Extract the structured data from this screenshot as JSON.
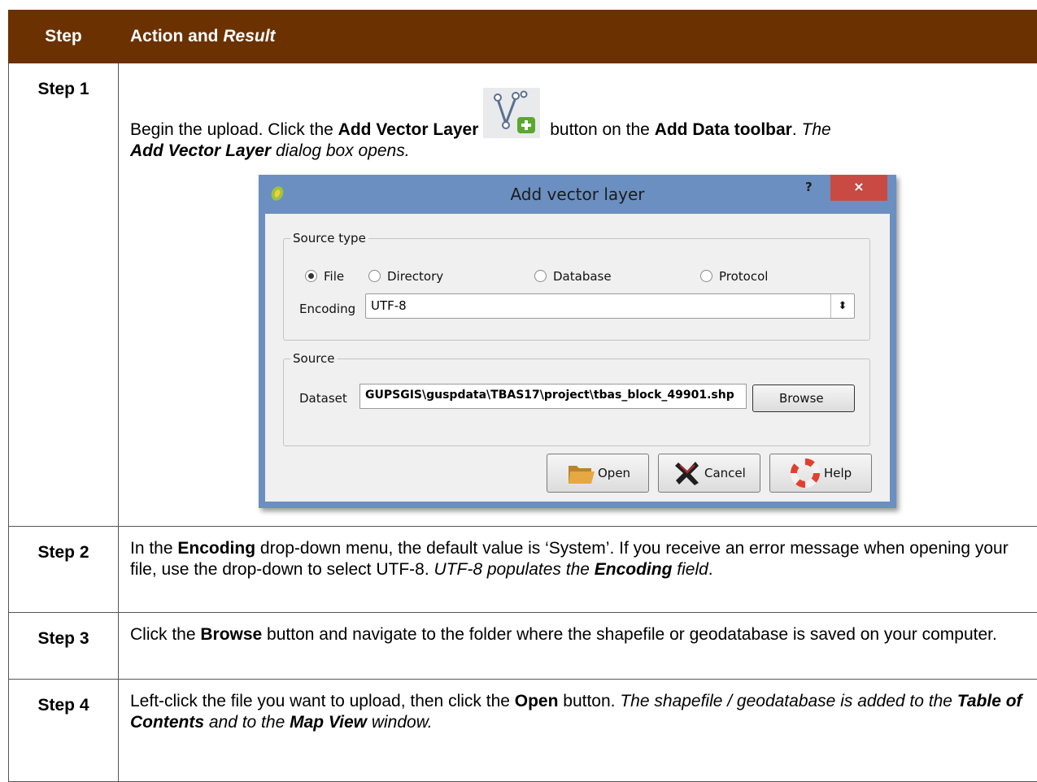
{
  "table": {
    "header": {
      "step": "Step",
      "action_plain": "Action and ",
      "action_italic": "Result"
    },
    "rows": [
      {
        "step": "Step 1"
      },
      {
        "step": "Step 2"
      },
      {
        "step": "Step 3"
      },
      {
        "step": "Step 4"
      }
    ]
  },
  "step1": {
    "t1": "Begin the upload. Click the ",
    "b1": "Add Vector Layer",
    "t2": " button on the ",
    "b2": "Add Data toolbar",
    "t3": ". ",
    "i1": "The",
    "bi1": "Add Vector Layer",
    "i2": " dialog box opens."
  },
  "step2": {
    "t1": "In the ",
    "b1": "Encoding",
    "t2": " drop-down menu, the default value is ‘System’. If you receive an error message when opening your file, use the drop-down to select UTF-8. ",
    "i1": "UTF-8 populates the ",
    "bi1": "Encoding",
    "i2": " field",
    "t3": "."
  },
  "step3": {
    "t1": "Click the ",
    "b1": "Browse",
    "t2": " button and navigate to the folder where the shapefile or geodatabase is saved on your computer."
  },
  "step4": {
    "t1": "Left-click the file you want to upload, then click the ",
    "b1": "Open",
    "t2": " button. ",
    "i1": "The shapefile / geodatabase is added to the ",
    "bi1": "Table of Contents",
    "i2": " and to the ",
    "bi2": "Map View",
    "i3": " window."
  },
  "dialog": {
    "title": "Add vector layer",
    "help_symbol": "?",
    "close_symbol": "×",
    "source_type_label": "Source type",
    "radios": [
      {
        "label": "File",
        "selected": true
      },
      {
        "label": "Directory",
        "selected": false
      },
      {
        "label": "Database",
        "selected": false
      },
      {
        "label": "Protocol",
        "selected": false
      }
    ],
    "encoding_label": "Encoding",
    "encoding_value": "UTF-8",
    "source_label": "Source",
    "dataset_label": "Dataset",
    "dataset_value": "GUPSGIS\\guspdata\\TBAS17\\project\\tbas_block_49901.shp",
    "browse_label": "Browse",
    "open_label": "Open",
    "cancel_label": "Cancel",
    "help_label": "Help"
  },
  "icons": [
    "add-vector-layer-icon",
    "qgis-logo-icon",
    "folder-icon",
    "cancel-x-icon",
    "lifebuoy-help-icon"
  ],
  "colors": {
    "header_bg": "#6b3100",
    "dialog_frame": "#6b8fc0",
    "close_red": "#c94a43"
  }
}
